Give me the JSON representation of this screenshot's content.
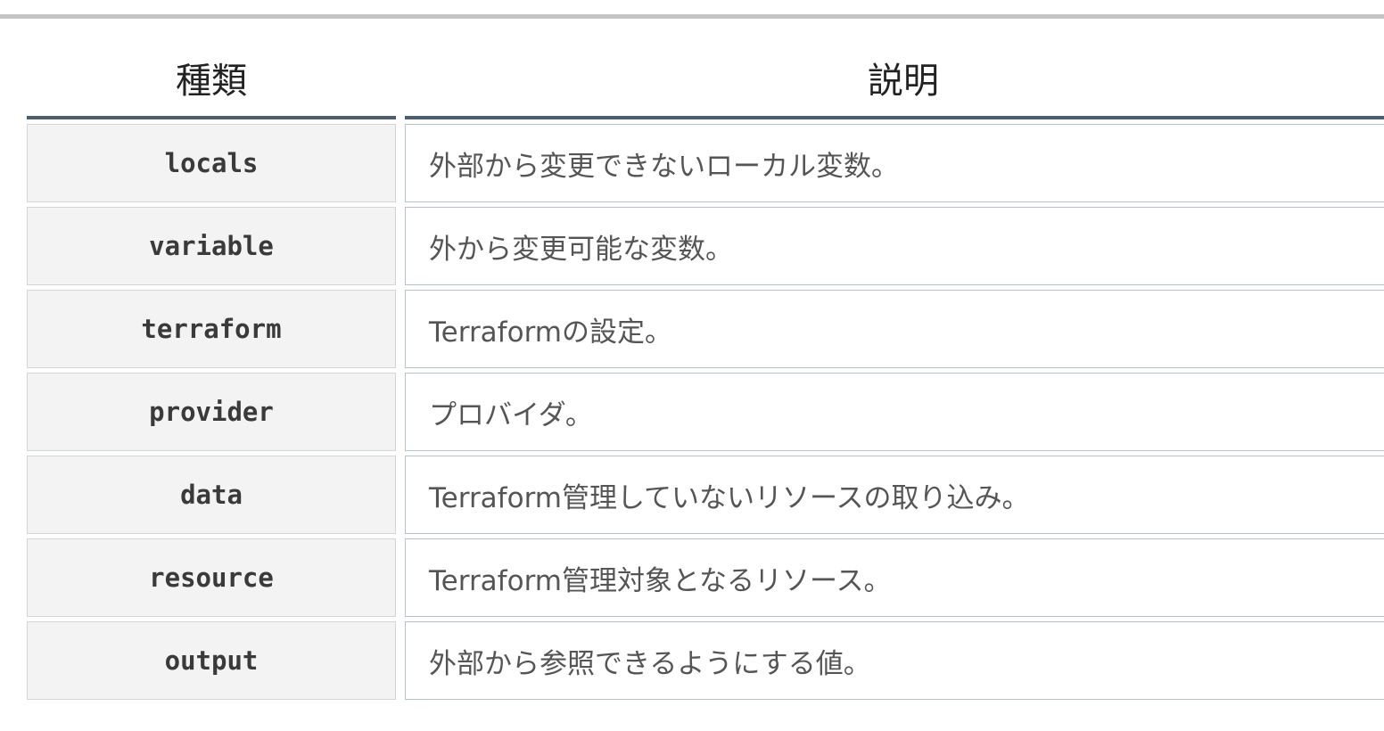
{
  "table": {
    "headers": [
      "種類",
      "説明"
    ],
    "rows": [
      {
        "kind": "locals",
        "description": "外部から変更できないローカル変数。"
      },
      {
        "kind": "variable",
        "description": "外から変更可能な変数。"
      },
      {
        "kind": "terraform",
        "description": "Terraformの設定。"
      },
      {
        "kind": "provider",
        "description": "プロバイダ。"
      },
      {
        "kind": "data",
        "description": "Terraform管理していないリソースの取り込み。"
      },
      {
        "kind": "resource",
        "description": "Terraform管理対象となるリソース。"
      },
      {
        "kind": "output",
        "description": "外部から参照できるようにする値。"
      }
    ]
  }
}
